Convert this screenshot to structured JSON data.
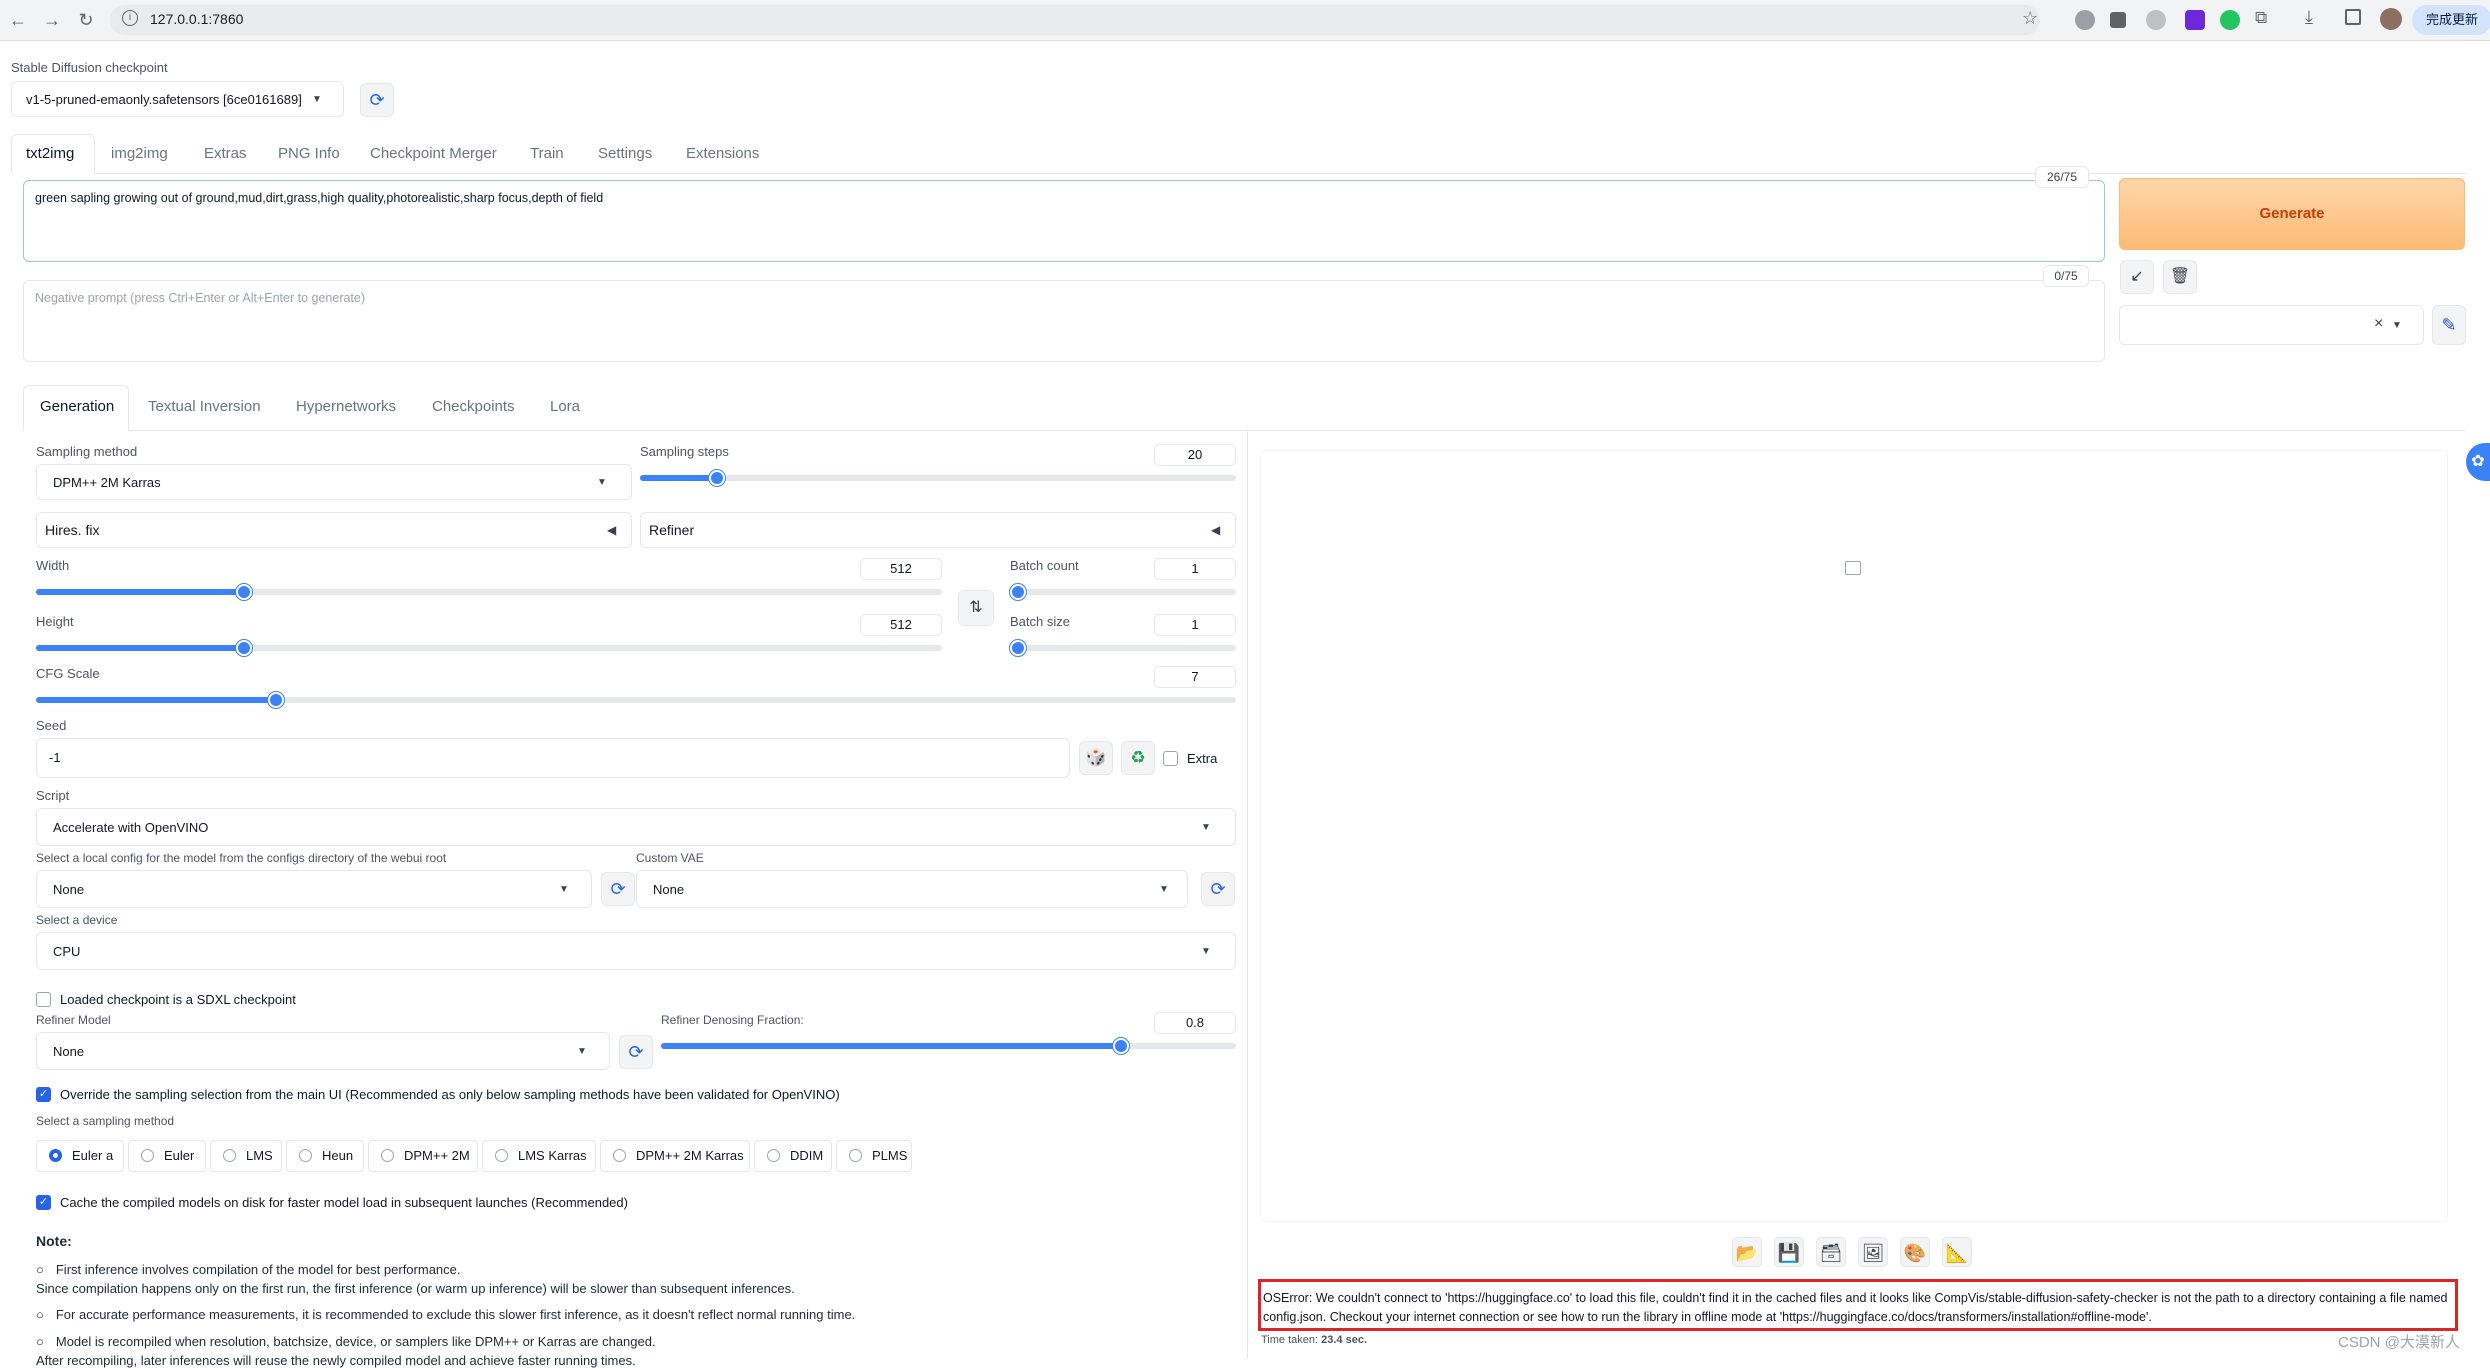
{
  "browser": {
    "url": "127.0.0.1:7860",
    "update_button": "完成更新"
  },
  "checkpoint": {
    "label": "Stable Diffusion checkpoint",
    "value": "v1-5-pruned-emaonly.safetensors [6ce0161689]"
  },
  "main_tabs": [
    "txt2img",
    "img2img",
    "Extras",
    "PNG Info",
    "Checkpoint Merger",
    "Train",
    "Settings",
    "Extensions"
  ],
  "prompt": {
    "value": "green sapling growing out of ground,mud,dirt,grass,high quality,photorealistic,sharp focus,depth of field",
    "token_count": "26/75"
  },
  "negative_prompt": {
    "placeholder": "Negative prompt (press Ctrl+Enter or Alt+Enter to generate)",
    "token_count": "0/75"
  },
  "generate_button": "Generate",
  "style_select": {
    "clear": "×"
  },
  "sub_tabs": [
    "Generation",
    "Textual Inversion",
    "Hypernetworks",
    "Checkpoints",
    "Lora"
  ],
  "sampling": {
    "method_label": "Sampling method",
    "method_value": "DPM++ 2M Karras",
    "steps_label": "Sampling steps",
    "steps_value": "20",
    "steps_fraction": 0.13
  },
  "accordions": {
    "hires": "Hires. fix",
    "refiner": "Refiner"
  },
  "dimensions": {
    "width_label": "Width",
    "width_value": "512",
    "width_fraction": 0.23,
    "height_label": "Height",
    "height_value": "512",
    "height_fraction": 0.23,
    "batch_count_label": "Batch count",
    "batch_count_value": "1",
    "batch_size_label": "Batch size",
    "batch_size_value": "1",
    "cfg_label": "CFG Scale",
    "cfg_value": "7",
    "cfg_fraction": 0.2
  },
  "seed": {
    "label": "Seed",
    "value": "-1",
    "extra_label": "Extra"
  },
  "script": {
    "label": "Script",
    "value": "Accelerate with OpenVINO"
  },
  "openvino": {
    "config_label": "Select a local config for the model from the configs directory of the webui root",
    "config_value": "None",
    "vae_label": "Custom VAE",
    "vae_value": "None",
    "device_label": "Select a device",
    "device_value": "CPU",
    "sdxl_label": "Loaded checkpoint is a SDXL checkpoint",
    "refiner_model_label": "Refiner Model",
    "refiner_model_value": "None",
    "refiner_fraction_label": "Refiner Denosing Fraction:",
    "refiner_fraction_value": "0.8",
    "refiner_fraction": 0.8,
    "override_label": "Override the sampling selection from the main UI (Recommended as only below sampling methods have been validated for OpenVINO)",
    "sampling_label": "Select a sampling method",
    "samplers": [
      "Euler a",
      "Euler",
      "LMS",
      "Heun",
      "DPM++ 2M",
      "LMS Karras",
      "DPM++ 2M Karras",
      "DDIM",
      "PLMS"
    ],
    "selected_sampler": "Euler a",
    "cache_label": "Cache the compiled models on disk for faster model load in subsequent launches (Recommended)"
  },
  "notes": {
    "title": "Note:",
    "lines": [
      "First inference involves compilation of the model for best performance.",
      "Since compilation happens only on the first run, the first inference (or warm up inference) will be slower than subsequent inferences.",
      "For accurate performance measurements, it is recommended to exclude this slower first inference, as it doesn't reflect normal running time.",
      "Model is recompiled when resolution, batchsize, device, or samplers like DPM++ or Karras are changed.",
      "After recompiling, later inferences will reuse the newly compiled model and achieve faster running times."
    ]
  },
  "output": {
    "error": "OSError: We couldn't connect to 'https://huggingface.co' to load this file, couldn't find it in the cached files and it looks like CompVis/stable-diffusion-safety-checker is not the path to a directory containing a file named config.json. Checkout your internet connection or see how to run the library in offline mode at 'https://huggingface.co/docs/transformers/installation#offline-mode'.",
    "time_label": "Time taken:",
    "time_value": "23.4 sec."
  },
  "watermark": "CSDN @大漠新人",
  "colors": {
    "accent": "#3b82f6",
    "generate_bg": "#fdba74",
    "generate_text": "#c2410c",
    "error_border": "#dc2626"
  }
}
